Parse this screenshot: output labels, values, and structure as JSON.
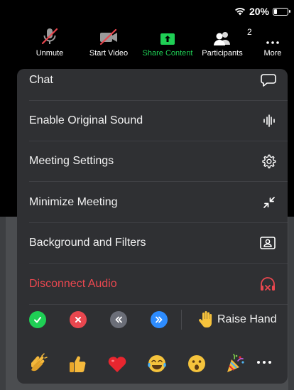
{
  "status_bar": {
    "battery": "20%",
    "battery_level": 0.2
  },
  "toolbar": {
    "unmute": "Unmute",
    "start_video": "Start Video",
    "share_content": "Share Content",
    "participants": "Participants",
    "participants_count": "2",
    "more": "More"
  },
  "menu": {
    "chat": "Chat",
    "original_sound": "Enable Original Sound",
    "meeting_settings": "Meeting Settings",
    "minimize": "Minimize Meeting",
    "background": "Background and Filters",
    "disconnect": "Disconnect Audio"
  },
  "reactions": {
    "raise_hand": "Raise Hand",
    "status_icons": [
      "check-icon",
      "x-icon",
      "slower-icon",
      "faster-icon"
    ],
    "emojis": [
      "clapping-hands-icon",
      "thumbs-up-icon",
      "heart-icon",
      "tears-of-joy-icon",
      "open-mouth-icon",
      "party-popper-icon"
    ]
  },
  "colors": {
    "accent_green": "#1fcf55",
    "danger_red": "#e9474f",
    "menu_bg": "#2f3033",
    "blue": "#2d8cff"
  }
}
